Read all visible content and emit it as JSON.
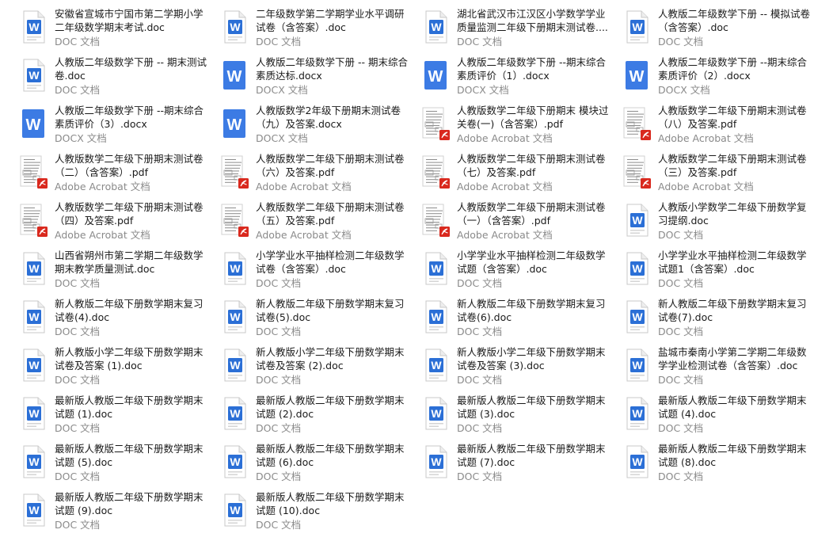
{
  "view": "large-icons-file-list",
  "columns": 4,
  "files": [
    {
      "name": "安徽省宣城市宁国市第二学期小学二年级数学期末考试.doc",
      "type": "DOC 文档",
      "icon": "word-doc-icon"
    },
    {
      "name": "二年级数学第二学期学业水平调研试卷（含答案）.doc",
      "type": "DOC 文档",
      "icon": "word-doc-icon"
    },
    {
      "name": "湖北省武汉市江汉区小学数学学业质量监测二年级下册期末测试卷....",
      "type": "DOC 文档",
      "icon": "word-doc-icon"
    },
    {
      "name": "人教版二年级数学下册 -- 模拟试卷（含答案）.doc",
      "type": "DOC 文档",
      "icon": "word-doc-icon"
    },
    {
      "name": "人教版二年级数学下册 -- 期末测试卷.doc",
      "type": "DOC 文档",
      "icon": "word-doc-icon"
    },
    {
      "name": "人教版二年级数学下册 -- 期末综合素质达标.docx",
      "type": "DOCX 文档",
      "icon": "word-docx-icon"
    },
    {
      "name": "人教版二年级数学下册 --期末综合素质评价（1）.docx",
      "type": "DOCX 文档",
      "icon": "word-docx-icon"
    },
    {
      "name": "人教版二年级数学下册 --期末综合素质评价（2）.docx",
      "type": "DOCX 文档",
      "icon": "word-docx-icon"
    },
    {
      "name": "人教版二年级数学下册 --期末综合素质评价（3）.docx",
      "type": "DOCX 文档",
      "icon": "word-docx-icon"
    },
    {
      "name": "人教版数学2年级下册期末测试卷（九）及答案.docx",
      "type": "DOCX 文档",
      "icon": "word-docx-icon"
    },
    {
      "name": "人教版数学二年级下册期末 模块过关卷(一)（含答案）.pdf",
      "type": "Adobe Acrobat 文档",
      "icon": "pdf-thumbnail-icon"
    },
    {
      "name": "人教版数学二年级下册期末测试卷（八）及答案.pdf",
      "type": "Adobe Acrobat 文档",
      "icon": "pdf-thumbnail-icon"
    },
    {
      "name": "人教版数学二年级下册期末测试卷（二）（含答案）.pdf",
      "type": "Adobe Acrobat 文档",
      "icon": "pdf-thumbnail-icon"
    },
    {
      "name": "人教版数学二年级下册期末测试卷（六）及答案.pdf",
      "type": "Adobe Acrobat 文档",
      "icon": "pdf-thumbnail-icon"
    },
    {
      "name": "人教版数学二年级下册期末测试卷（七）及答案.pdf",
      "type": "Adobe Acrobat 文档",
      "icon": "pdf-thumbnail-icon"
    },
    {
      "name": "人教版数学二年级下册期末测试卷（三）及答案.pdf",
      "type": "Adobe Acrobat 文档",
      "icon": "pdf-thumbnail-icon"
    },
    {
      "name": "人教版数学二年级下册期末测试卷（四）及答案.pdf",
      "type": "Adobe Acrobat 文档",
      "icon": "pdf-thumbnail-icon"
    },
    {
      "name": "人教版数学二年级下册期末测试卷（五）及答案.pdf",
      "type": "Adobe Acrobat 文档",
      "icon": "pdf-thumbnail-icon"
    },
    {
      "name": "人教版数学二年级下册期末测试卷（一）（含答案）.pdf",
      "type": "Adobe Acrobat 文档",
      "icon": "pdf-thumbnail-icon"
    },
    {
      "name": "人教版小学数学二年级下册数学复习提纲.doc",
      "type": "DOC 文档",
      "icon": "word-doc-icon"
    },
    {
      "name": "山西省朔州市第二学期二年级数学期末教学质量测试.doc",
      "type": "DOC 文档",
      "icon": "word-doc-icon"
    },
    {
      "name": "小学学业水平抽样检测二年级数学试卷（含答案）.doc",
      "type": "DOC 文档",
      "icon": "word-doc-icon"
    },
    {
      "name": "小学学业水平抽样检测二年级数学试题（含答案）.doc",
      "type": "DOC 文档",
      "icon": "word-doc-icon"
    },
    {
      "name": "小学学业水平抽样检测二年级数学试题1（含答案）.doc",
      "type": "DOC 文档",
      "icon": "word-doc-icon"
    },
    {
      "name": "新人教版二年级下册数学期末复习试卷(4).doc",
      "type": "DOC 文档",
      "icon": "word-doc-icon"
    },
    {
      "name": "新人教版二年级下册数学期末复习试卷(5).doc",
      "type": "DOC 文档",
      "icon": "word-doc-icon"
    },
    {
      "name": "新人教版二年级下册数学期末复习试卷(6).doc",
      "type": "DOC 文档",
      "icon": "word-doc-icon"
    },
    {
      "name": "新人教版二年级下册数学期末复习试卷(7).doc",
      "type": "DOC 文档",
      "icon": "word-doc-icon"
    },
    {
      "name": "新人教版小学二年级下册数学期末试卷及答案 (1).doc",
      "type": "DOC 文档",
      "icon": "word-doc-icon"
    },
    {
      "name": "新人教版小学二年级下册数学期末试卷及答案 (2).doc",
      "type": "DOC 文档",
      "icon": "word-doc-icon"
    },
    {
      "name": "新人教版小学二年级下册数学期末试卷及答案 (3).doc",
      "type": "DOC 文档",
      "icon": "word-doc-icon"
    },
    {
      "name": "盐城市秦南小学第二学期二年级数学学业检测试卷（含答案）.doc",
      "type": "DOC 文档",
      "icon": "word-doc-icon"
    },
    {
      "name": "最新版人教版二年级下册数学期末试题 (1).doc",
      "type": "DOC 文档",
      "icon": "word-doc-icon"
    },
    {
      "name": "最新版人教版二年级下册数学期末试题 (2).doc",
      "type": "DOC 文档",
      "icon": "word-doc-icon"
    },
    {
      "name": "最新版人教版二年级下册数学期末试题 (3).doc",
      "type": "DOC 文档",
      "icon": "word-doc-icon"
    },
    {
      "name": "最新版人教版二年级下册数学期末试题 (4).doc",
      "type": "DOC 文档",
      "icon": "word-doc-icon"
    },
    {
      "name": "最新版人教版二年级下册数学期末试题 (5).doc",
      "type": "DOC 文档",
      "icon": "word-doc-icon"
    },
    {
      "name": "最新版人教版二年级下册数学期末试题 (6).doc",
      "type": "DOC 文档",
      "icon": "word-doc-icon"
    },
    {
      "name": "最新版人教版二年级下册数学期末试题 (7).doc",
      "type": "DOC 文档",
      "icon": "word-doc-icon"
    },
    {
      "name": "最新版人教版二年级下册数学期末试题 (8).doc",
      "type": "DOC 文档",
      "icon": "word-doc-icon"
    },
    {
      "name": "最新版人教版二年级下册数学期末试题 (9).doc",
      "type": "DOC 文档",
      "icon": "word-doc-icon"
    },
    {
      "name": "最新版人教版二年级下册数学期末试题 (10).doc",
      "type": "DOC 文档",
      "icon": "word-doc-icon"
    }
  ],
  "colors": {
    "doc_blue": "#2b6fd6",
    "docx_blue": "#3c7be4",
    "pdf_red": "#d9291e",
    "name_text": "#1a1a1a",
    "type_text": "#8a8a8a"
  }
}
